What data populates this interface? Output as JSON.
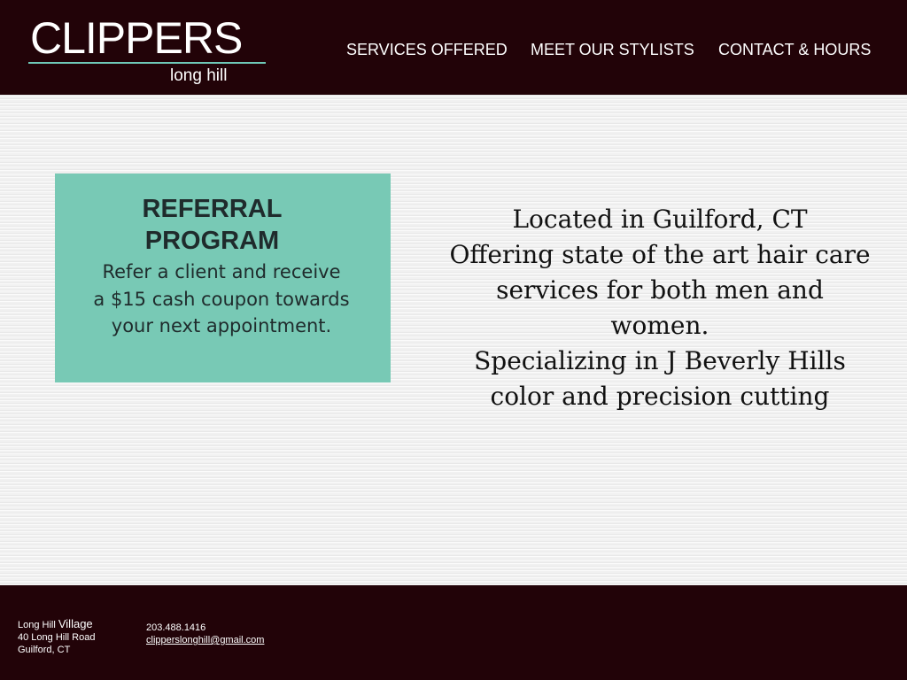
{
  "header": {
    "logo_main": "CLIPPERS",
    "logo_sub": "long hill",
    "nav": [
      {
        "label": "SERVICES OFFERED"
      },
      {
        "label": "MEET OUR STYLISTS"
      },
      {
        "label": "CONTACT & HOURS"
      }
    ]
  },
  "referral": {
    "title_line1": "REFERRAL",
    "title_line2": "PROGRAM",
    "body_line1": "Refer a client and receive",
    "body_line2": "a $15 cash coupon towards",
    "body_line3": "your next appointment."
  },
  "about": {
    "lines": [
      "Located in Guilford, CT",
      "Offering state of the art hair care",
      "services for both men and",
      "women.",
      "Specializing in J Beverly Hills",
      "color and precision cutting"
    ]
  },
  "footer": {
    "address_prefix": "Long Hill ",
    "address_village": "Village",
    "address_street": "40 Long Hill Road",
    "address_city": "Guilford, CT",
    "phone": "203.488.1416",
    "email": "clipperslonghill@gmail.com"
  },
  "colors": {
    "header_bg": "#220308",
    "footer_bg": "#220308",
    "accent_teal": "#6fc8b7",
    "referral_bg": "#78c9b5",
    "page_bg": "#f1f1f1"
  }
}
